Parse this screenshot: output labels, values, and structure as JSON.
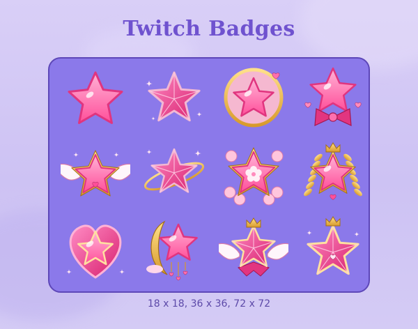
{
  "title": "Twitch Badges",
  "sizes_caption": "18 x 18, 36 x 36, 72 x 72",
  "colors": {
    "background": "#d4cbf5",
    "panel": "#8b79ea",
    "title": "#6f52cf",
    "star_pink": "#ff6fae",
    "gold": "#e8b44a"
  },
  "badges": [
    {
      "name": "plain-star-icon"
    },
    {
      "name": "faceted-star-icon"
    },
    {
      "name": "star-in-ring-icon"
    },
    {
      "name": "star-with-bow-icon"
    },
    {
      "name": "winged-star-icon"
    },
    {
      "name": "star-with-orbit-ring-icon"
    },
    {
      "name": "cherry-blossom-star-icon"
    },
    {
      "name": "crowned-star-laurel-icon"
    },
    {
      "name": "heart-gem-star-icon"
    },
    {
      "name": "moon-star-icon"
    },
    {
      "name": "ribbon-winged-star-icon"
    },
    {
      "name": "crowned-faceted-star-icon"
    }
  ]
}
